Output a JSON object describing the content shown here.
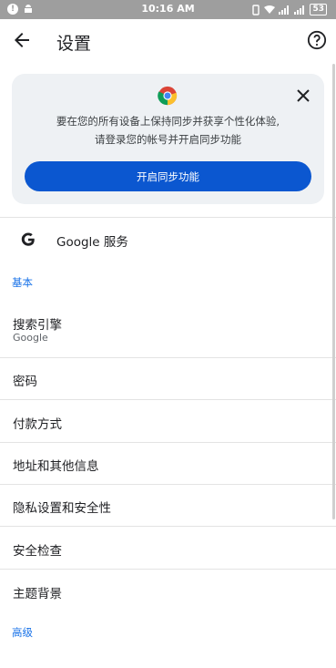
{
  "status_bar": {
    "time": "10:16 AM",
    "battery": "53"
  },
  "app_bar": {
    "title": "设置"
  },
  "sync_card": {
    "message_line1": "要在您的所有设备上保持同步并获享个性化体验,",
    "message_line2": "请登录您的帐号并开启同步功能",
    "button_label": "开启同步功能"
  },
  "google_services": {
    "label": "Google 服务"
  },
  "sections": {
    "basic": "基本",
    "advanced": "高级"
  },
  "items": [
    {
      "label": "搜索引擎",
      "sub": "Google"
    },
    {
      "label": "密码"
    },
    {
      "label": "付款方式"
    },
    {
      "label": "地址和其他信息"
    },
    {
      "label": "隐私设置和安全性"
    },
    {
      "label": "安全检查"
    },
    {
      "label": "主题背景"
    }
  ],
  "colors": {
    "accent": "#0b57d0",
    "section": "#1a73e8",
    "card": "#eef1f4"
  }
}
